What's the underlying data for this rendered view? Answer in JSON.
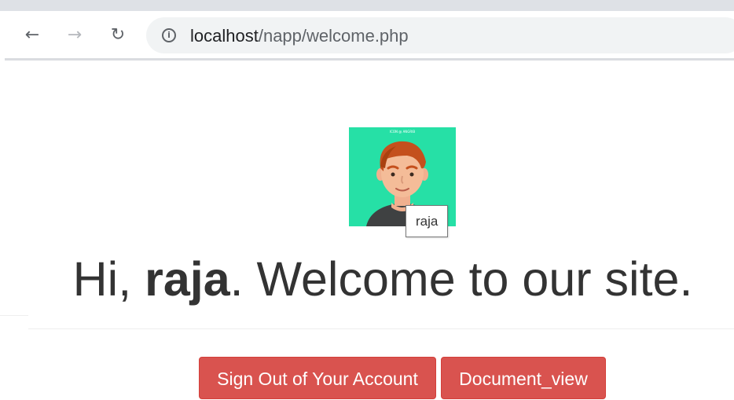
{
  "browser": {
    "back_icon": "back-arrow-icon",
    "forward_icon": "forward-arrow-icon",
    "reload_icon": "reload-icon",
    "info_icon": "info-icon",
    "url_host": "localhost",
    "url_path": "/napp/welcome.php"
  },
  "profile": {
    "avatar_badge": "ICON @ ANGRIB",
    "tooltip": "raja"
  },
  "welcome": {
    "prefix": "Hi, ",
    "username": "raja",
    "suffix": ". Welcome to our site."
  },
  "actions": {
    "sign_out_label": "Sign Out of Your Account",
    "document_view_label": "Document_view"
  },
  "colors": {
    "avatar_bg": "#26e0a6",
    "button_danger": "#d9534f",
    "text": "#333333"
  }
}
